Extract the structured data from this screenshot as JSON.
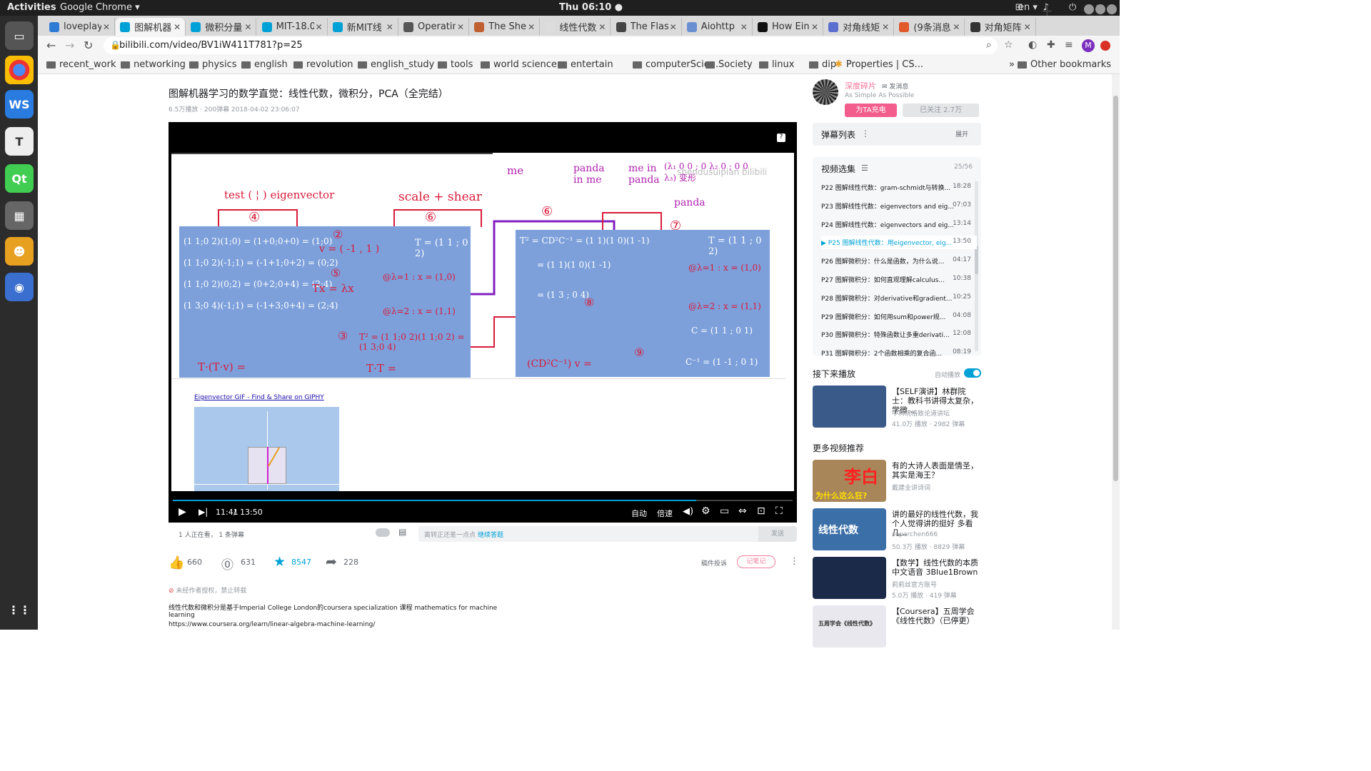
{
  "system": {
    "activities": "Activities",
    "app": "Google Chrome ▾",
    "clock": "Thu 06:10 ●",
    "lang": "en ▾",
    "tray": "⊞ ♪ ⏻ ▾"
  },
  "tabs": [
    {
      "title": "loveplay",
      "color": "#2e7bd6"
    },
    {
      "title": "图解机器",
      "color": "#00a1d6"
    },
    {
      "title": "微积分量",
      "color": "#00a1d6"
    },
    {
      "title": "MIT-18.0",
      "color": "#00a1d6"
    },
    {
      "title": "新MIT线",
      "color": "#00a1d6"
    },
    {
      "title": "Operatin",
      "color": "#555"
    },
    {
      "title": "The Shel",
      "color": "#c06030"
    },
    {
      "title": "线性代数",
      "color": "#ddd"
    },
    {
      "title": "The Flas",
      "color": "#444"
    },
    {
      "title": "Aiohttp",
      "color": "#6a8fd0"
    },
    {
      "title": "How Ein",
      "color": "#111"
    },
    {
      "title": "对角线矩",
      "color": "#5a6fd0"
    },
    {
      "title": "(9条消息",
      "color": "#e05a2a"
    },
    {
      "title": "对角矩阵",
      "color": "#333"
    }
  ],
  "address": {
    "url": "bilibili.com/video/BV1iW411T781?p=25"
  },
  "bookmarks": [
    "recent_work",
    "networking",
    "physics",
    "english",
    "revolution",
    "english_study",
    "tools",
    "world science",
    "entertain",
    "computerScie...",
    "Society",
    "linux",
    "dip",
    "Properties | CS...",
    "Other bookmarks"
  ],
  "video": {
    "title": "图解机器学习的数学直觉：线性代数，微积分，PCA（全完结）",
    "meta": "6.5万播放 · 200弹幕    2018-04-02 23:06:07",
    "time_current": "11:41",
    "time_sep": "/",
    "time_total": "13:50",
    "progress": 0.845,
    "ctrl_auto": "自动",
    "ctrl_speed": "倍速",
    "watching": "1 人正在看， 1 条弹幕",
    "danmu_placeholder": "离转正还差一点点",
    "danmu_link": "继续答题",
    "send": "发送",
    "frame": {
      "label_test": "test ( ¦ ) eigenvector",
      "label_scale": "scale + shear",
      "label_me1": "me",
      "label_panda1": "panda in me",
      "label_me2": "me in panda",
      "label_panda2": "panda",
      "n2": "②",
      "n3": "③",
      "n4": "④",
      "n5": "⑤",
      "n6": "⑥",
      "n7": "⑦",
      "n8": "⑧",
      "n9": "⑨",
      "n0": "⑥",
      "eq_v": "v = ( -1 , 1 )",
      "eq_tx": "Tx = λx",
      "eq_l1": "@λ=1 : x = (1,0)",
      "eq_l2": "@λ=2 : x = (1,1)",
      "eq_t2": "T² = (1 1;0 2)(1 1;0 2) = (1 3;0 4)",
      "eq_ttv": "T·(T·v) =",
      "eq_tt": "T·T =",
      "eq_r1": "T² = CD²C⁻¹ = (1 1)(1 0)(1 -1)",
      "eq_r2": "= (1 1)(1 0)(1 -1)",
      "eq_r3": "= (1 3 ; 0 4)",
      "eq_rT": "T = (1 1 ; 0 2)",
      "eq_rl1": "@λ=1 : x = (1,0)",
      "eq_rl2": "@λ=2 : x = (1,1)",
      "eq_rC": "C = (1 1 ; 0 1)",
      "eq_rCi": "C⁻¹ = (1 -1 ; 0 1)",
      "eq_rcd": "(CD²C⁻¹) v =",
      "mat_rows": [
        "(1 1;0 2)(1;0) = (1+0;0+0) = (1;0)",
        "(1 1;0 2)(-1;1) = (-1+1;0+2) = (0;2)",
        "(1 1;0 2)(0;2) = (0+2;0+4) = (2;4)",
        "(1 3;0 4)(-1;1) = (-1+3;0+4) = (2;4)"
      ],
      "diag": "(λ₁ 0 0 ; 0 λ₂ 0 ; 0 0 λ₃) 变形",
      "watermark": "shendusuipian bilibili",
      "gif_link": "Eigenvector GIF - Find & Share on GIPHY"
    }
  },
  "actions": {
    "like": "660",
    "coin": "631",
    "star": "8547",
    "share": "228",
    "report": "稿件投诉",
    "note": "记笔记"
  },
  "desc": {
    "notice": "未经作者授权，禁止转载",
    "line1": "线性代数和微积分是基于Imperial College London的coursera specialization 课程 mathematics for machine",
    "line2": "learning",
    "line3": "https://www.coursera.org/learn/linear-algebra-machine-learning/"
  },
  "uploader": {
    "name": "深度碎片",
    "msg": "发消息",
    "sign": "As Simple As Possible",
    "charge": "为TA充电",
    "follow": "已关注 2.7万"
  },
  "danmu_list": {
    "title": "弹幕列表",
    "more": "⋮",
    "expand": "展开"
  },
  "playlist": {
    "title": "视频选集",
    "count": "25/56",
    "items": [
      {
        "p": "P22",
        "t": "图解线性代数：gram-schmidt与转换...",
        "d": "18:28"
      },
      {
        "p": "P23",
        "t": "图解线性代数：eigenvectors and eig...",
        "d": "07:03"
      },
      {
        "p": "P24",
        "t": "图解线性代数：eigenvectors and eig...",
        "d": "13:14"
      },
      {
        "p": "P25",
        "t": "图解线性代数：用eigenvector, eig...",
        "d": "13:50"
      },
      {
        "p": "P26",
        "t": "图解微积分：什么是函数，为什么说...",
        "d": "04:17"
      },
      {
        "p": "P27",
        "t": "图解微积分：如何直观理解calculus...",
        "d": "10:38"
      },
      {
        "p": "P28",
        "t": "图解微积分：对derivative和gradient...",
        "d": "10:25"
      },
      {
        "p": "P29",
        "t": "图解微积分：如何用sum和power规...",
        "d": "04:08"
      },
      {
        "p": "P30",
        "t": "图解微积分：特殊函数让多重derivati...",
        "d": "12:08"
      },
      {
        "p": "P31",
        "t": "图解微积分：2个函数相乘的复合函...",
        "d": "08:19"
      }
    ]
  },
  "next_up": {
    "title": "接下来播放",
    "autoplay": "自动播放"
  },
  "more_title": "更多视频推荐",
  "recs": [
    {
      "t": "【SELF演讲】林群院士：教科书讲得太复杂，学微...",
      "a": "中科院格致论道讲坛",
      "s": "41.0万 播放 · 2982 弹幕",
      "color": "#3a5a8a"
    },
    {
      "t": "有的大诗人表面是情圣，其实是海王？",
      "a": "戴建业讲诗词",
      "s": "",
      "color": "#a8865a",
      "overlay": "李白",
      "overlay2": "为什么这么狂?"
    },
    {
      "t": "讲的最好的线性代数，我个人觉得讲的挺好 多看几...",
      "a": "superchen666",
      "s": "50.3万 播放 · 8829 弹幕",
      "color": "#3b6fa8",
      "overlay": "线性代数"
    },
    {
      "t": "【数学】线性代数的本质 中文语音 3Blue1Brown",
      "a": "莉莉丝官方账号",
      "s": "5.0万 播放 · 419 弹幕",
      "color": "#1c2a4a"
    },
    {
      "t": "【Coursera】五周学会《线性代数》（已停更）",
      "a": "",
      "s": "",
      "color": "#e8e8ee",
      "overlay": "五周学会《线性代数》"
    }
  ]
}
